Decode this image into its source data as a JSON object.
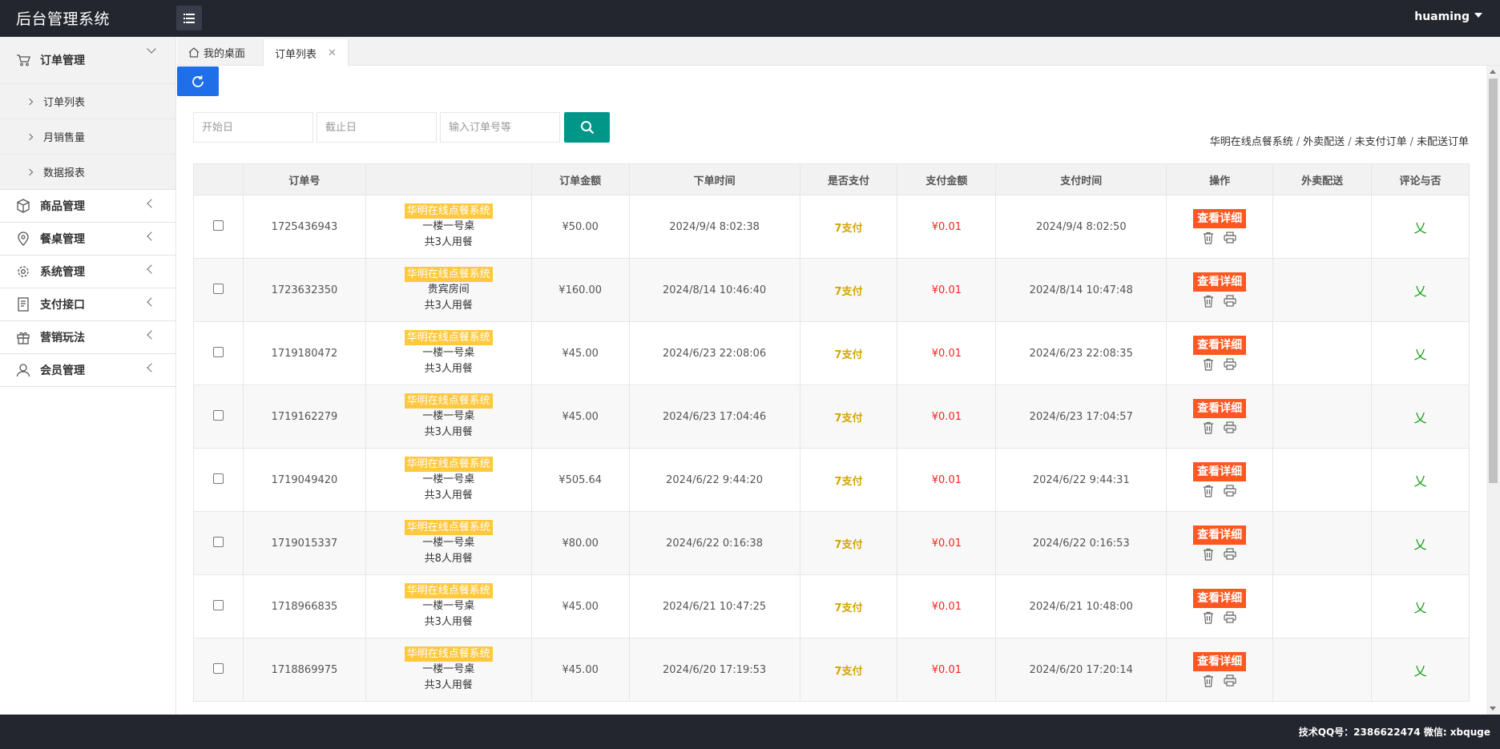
{
  "header": {
    "brand": "后台管理系统",
    "user": "huaming"
  },
  "sidebar": {
    "groups": [
      {
        "label": "订单管理",
        "icon": "cart-icon",
        "open": true,
        "items": [
          {
            "label": "订单列表"
          },
          {
            "label": "月销售量"
          },
          {
            "label": "数据报表"
          }
        ]
      },
      {
        "label": "商品管理",
        "icon": "box-icon"
      },
      {
        "label": "餐桌管理",
        "icon": "location-pin-icon"
      },
      {
        "label": "系统管理",
        "icon": "gear-icon"
      },
      {
        "label": "支付接口",
        "icon": "receipt-icon"
      },
      {
        "label": "营销玩法",
        "icon": "gift-icon"
      },
      {
        "label": "会员管理",
        "icon": "user-icon"
      }
    ]
  },
  "tabs": {
    "home": "我的桌面",
    "active": "订单列表"
  },
  "filters": {
    "start_placeholder": "开始日",
    "end_placeholder": "截止日",
    "order_placeholder": "输入订单号等"
  },
  "breadcrumb": [
    "华明在线点餐系统",
    "外卖配送",
    "未支付订单",
    "未配送订单"
  ],
  "table": {
    "headers": [
      "",
      "订单号",
      "",
      "订单金额",
      "下单时间",
      "是否支付",
      "支付金额",
      "支付时间",
      "操作",
      "外卖配送",
      "评论与否"
    ],
    "detail_label": "查看详细",
    "rows": [
      {
        "id": "1725436943",
        "shop": "华明在线点餐系统",
        "table": "一楼一号桌",
        "guests": "共3人用餐",
        "amount": "¥50.00",
        "order_time": "2024/9/4 8:02:38",
        "paid": "7支付",
        "pay_amount": "¥0.01",
        "pay_time": "2024/9/4 8:02:50",
        "comment": "乂"
      },
      {
        "id": "1723632350",
        "shop": "华明在线点餐系统",
        "table": "贵宾房间",
        "guests": "共3人用餐",
        "amount": "¥160.00",
        "order_time": "2024/8/14 10:46:40",
        "paid": "7支付",
        "pay_amount": "¥0.01",
        "pay_time": "2024/8/14 10:47:48",
        "comment": "乂"
      },
      {
        "id": "1719180472",
        "shop": "华明在线点餐系统",
        "table": "一楼一号桌",
        "guests": "共3人用餐",
        "amount": "¥45.00",
        "order_time": "2024/6/23 22:08:06",
        "paid": "7支付",
        "pay_amount": "¥0.01",
        "pay_time": "2024/6/23 22:08:35",
        "comment": "乂"
      },
      {
        "id": "1719162279",
        "shop": "华明在线点餐系统",
        "table": "一楼一号桌",
        "guests": "共3人用餐",
        "amount": "¥45.00",
        "order_time": "2024/6/23 17:04:46",
        "paid": "7支付",
        "pay_amount": "¥0.01",
        "pay_time": "2024/6/23 17:04:57",
        "comment": "乂"
      },
      {
        "id": "1719049420",
        "shop": "华明在线点餐系统",
        "table": "一楼一号桌",
        "guests": "共3人用餐",
        "amount": "¥505.64",
        "order_time": "2024/6/22 9:44:20",
        "paid": "7支付",
        "pay_amount": "¥0.01",
        "pay_time": "2024/6/22 9:44:31",
        "comment": "乂"
      },
      {
        "id": "1719015337",
        "shop": "华明在线点餐系统",
        "table": "一楼一号桌",
        "guests": "共8人用餐",
        "amount": "¥80.00",
        "order_time": "2024/6/22 0:16:38",
        "paid": "7支付",
        "pay_amount": "¥0.01",
        "pay_time": "2024/6/22 0:16:53",
        "comment": "乂"
      },
      {
        "id": "1718966835",
        "shop": "华明在线点餐系统",
        "table": "一楼一号桌",
        "guests": "共3人用餐",
        "amount": "¥45.00",
        "order_time": "2024/6/21 10:47:25",
        "paid": "7支付",
        "pay_amount": "¥0.01",
        "pay_time": "2024/6/21 10:48:00",
        "comment": "乂"
      },
      {
        "id": "1718869975",
        "shop": "华明在线点餐系统",
        "table": "一楼一号桌",
        "guests": "共3人用餐",
        "amount": "¥45.00",
        "order_time": "2024/6/20 17:19:53",
        "paid": "7支付",
        "pay_amount": "¥0.01",
        "pay_time": "2024/6/20 17:20:14",
        "comment": "乂"
      }
    ]
  },
  "footer": {
    "text": "技术QQ号：2386622474 微信: xbquge"
  },
  "colors": {
    "header_bg": "#23262e",
    "refresh_btn": "#1e6fe8",
    "search_btn": "#009688",
    "detail_btn": "#ff5722",
    "badge": "#ffb800",
    "pay_amount": "#ff2222",
    "comment_mark": "#1aa01a"
  }
}
